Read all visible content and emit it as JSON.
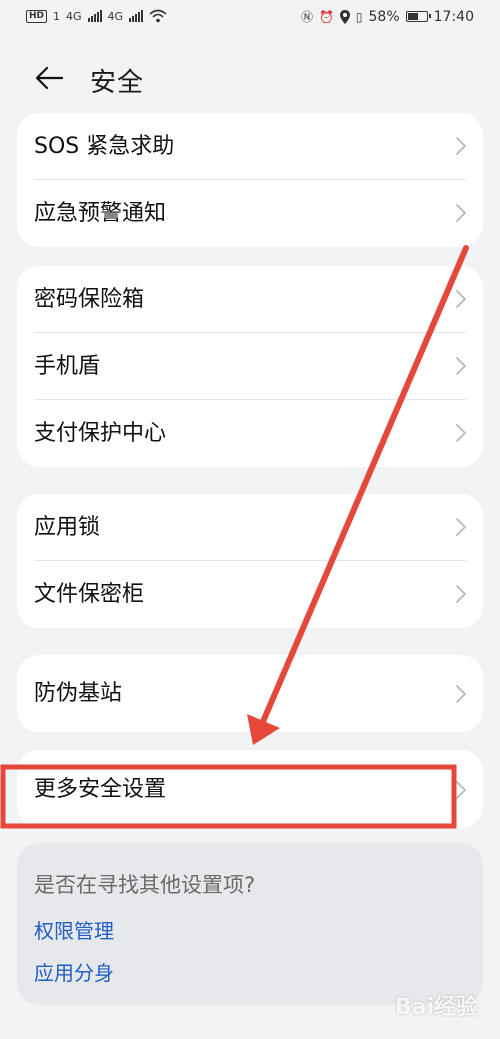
{
  "status_bar": {
    "network_a": "4G",
    "network_b": "4G",
    "sim_a": "1",
    "hd": "HD",
    "battery": "58%",
    "battery_level": 0.58,
    "time": "17:40"
  },
  "header": {
    "title": "安全",
    "back_icon": "back-arrow-icon"
  },
  "groups": [
    {
      "items": [
        {
          "label": "SOS 紧急求助"
        },
        {
          "label": "应急预警通知"
        }
      ]
    },
    {
      "items": [
        {
          "label": "密码保险箱"
        },
        {
          "label": "手机盾"
        },
        {
          "label": "支付保护中心"
        }
      ]
    },
    {
      "items": [
        {
          "label": "应用锁"
        },
        {
          "label": "文件保密柜"
        }
      ]
    },
    {
      "items": [
        {
          "label": "防伪基站"
        }
      ]
    },
    {
      "items": [
        {
          "label": "更多安全设置"
        }
      ]
    }
  ],
  "suggest": {
    "question": "是否在寻找其他设置项?",
    "links": [
      {
        "label": "权限管理"
      },
      {
        "label": "应用分身"
      }
    ]
  },
  "annotation": {
    "color": "#e5483a"
  },
  "watermark": "Bai经验"
}
